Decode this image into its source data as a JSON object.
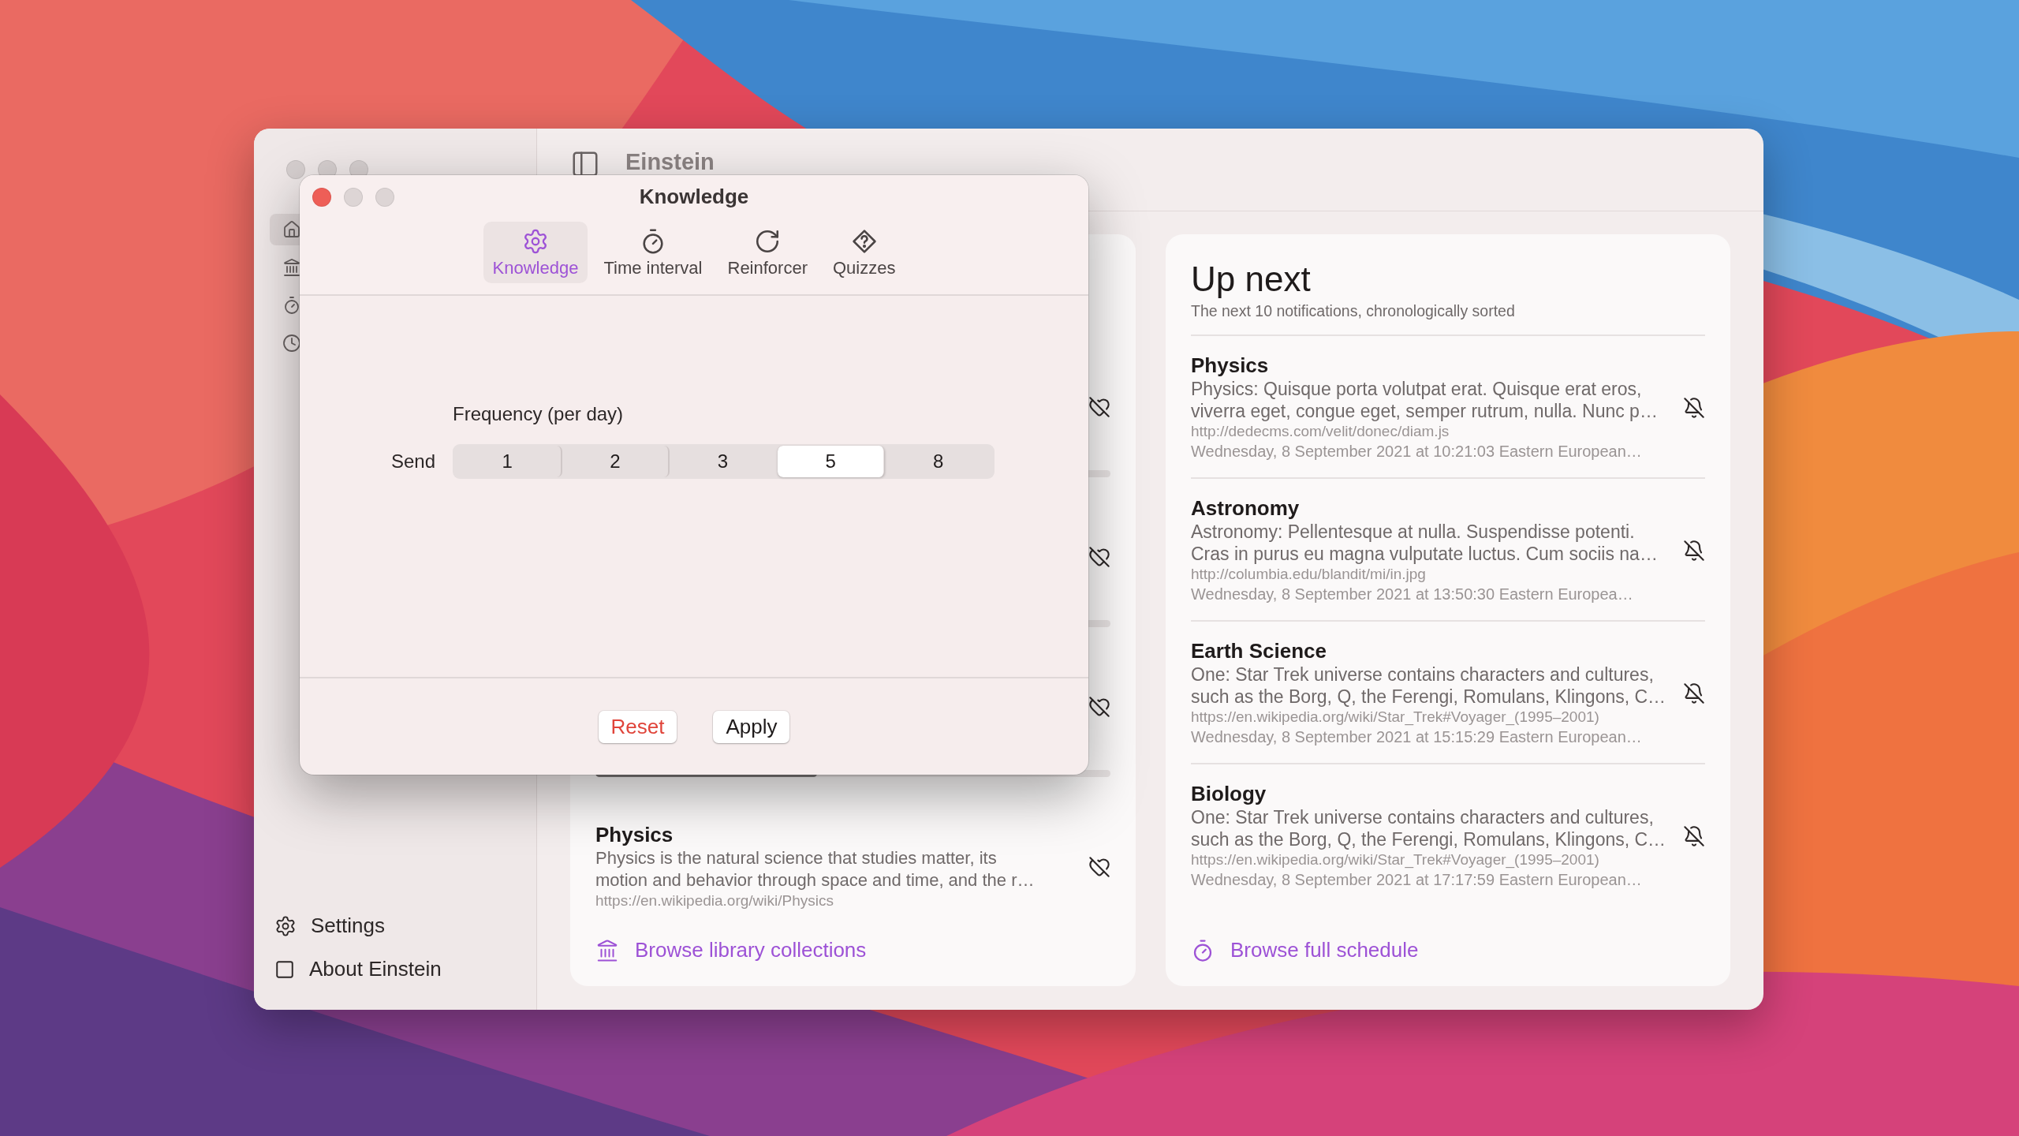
{
  "main_window": {
    "title": "Einstein",
    "sidebar": {
      "nav": [
        {
          "kind": "home",
          "selected": true
        },
        {
          "kind": "library",
          "selected": false
        },
        {
          "kind": "timer",
          "selected": false
        },
        {
          "kind": "clock",
          "selected": false
        }
      ],
      "footer": [
        {
          "kind": "settings",
          "label": "Settings"
        },
        {
          "kind": "about",
          "label": "About Einstein"
        }
      ]
    },
    "library": {
      "items": [
        {
          "kind": "covered"
        },
        {
          "kind": "covered"
        },
        {
          "kind": "covered",
          "level": 0.43
        },
        {
          "kind": "entry",
          "title": "Physics",
          "description": "Physics is the natural science that studies matter, its motion and behavior through space and time, and the r…",
          "url": "https://en.wikipedia.org/wiki/Physics"
        }
      ],
      "link": "Browse library collections"
    },
    "up_next": {
      "title": "Up next",
      "subtitle": "The next 10 notifications, chronologically sorted",
      "items": [
        {
          "title": "Physics",
          "description": "Physics: Quisque porta volutpat erat. Quisque erat eros, viverra eget, congue eget, semper rutrum, nulla. Nunc p…",
          "url": "http://dedecms.com/velit/donec/diam.js",
          "date": "Wednesday, 8 September 2021 at 10:21:03 Eastern European…"
        },
        {
          "title": "Astronomy",
          "description": "Astronomy: Pellentesque at nulla. Suspendisse potenti. Cras in purus eu magna vulputate luctus. Cum sociis na…",
          "url": "http://columbia.edu/blandit/mi/in.jpg",
          "date": "Wednesday, 8 September 2021 at 13:50:30 Eastern Europea…"
        },
        {
          "title": "Earth Science",
          "description": "One: Star Trek universe contains characters and cultures, such as the Borg, Q, the Ferengi, Romulans, Klingons, C…",
          "url": "https://en.wikipedia.org/wiki/Star_Trek#Voyager_(1995–2001)",
          "date": "Wednesday, 8 September 2021 at 15:15:29 Eastern European…"
        },
        {
          "title": "Biology",
          "description": "One: Star Trek universe contains characters and cultures, such as the Borg, Q, the Ferengi, Romulans, Klingons, C…",
          "url": "https://en.wikipedia.org/wiki/Star_Trek#Voyager_(1995–2001)",
          "date": "Wednesday, 8 September 2021 at 17:17:59 Eastern European…"
        }
      ],
      "link": "Browse full schedule"
    }
  },
  "dialog": {
    "title": "Knowledge",
    "tabs": [
      {
        "kind": "knowledge",
        "label": "Knowledge",
        "selected": true
      },
      {
        "kind": "interval",
        "label": "Time interval",
        "selected": false
      },
      {
        "kind": "reinforcer",
        "label": "Reinforcer",
        "selected": false
      },
      {
        "kind": "quizzes",
        "label": "Quizzes",
        "selected": false
      }
    ],
    "frequency": {
      "heading": "Frequency (per day)",
      "label": "Send",
      "options": [
        {
          "label": "1",
          "selected": false
        },
        {
          "label": "2",
          "selected": false
        },
        {
          "label": "3",
          "selected": false
        },
        {
          "label": "5",
          "selected": true
        },
        {
          "label": "8",
          "selected": false
        }
      ]
    },
    "buttons": [
      {
        "kind": "destructive",
        "label": "Reset"
      },
      {
        "kind": "default",
        "label": "Apply"
      }
    ]
  }
}
